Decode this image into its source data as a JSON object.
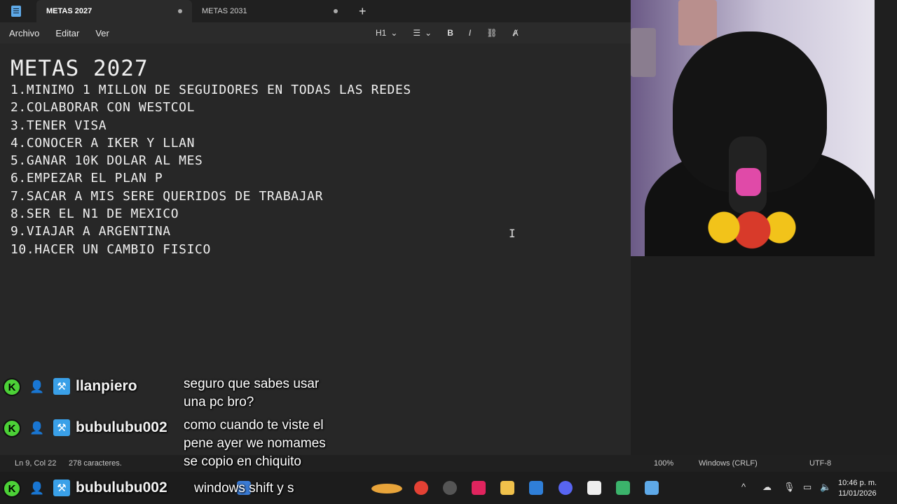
{
  "tabs": [
    {
      "label": "METAS 2027"
    },
    {
      "label": "METAS 2031"
    }
  ],
  "new_tab_label": "+",
  "menu": {
    "archivo": "Archivo",
    "editar": "Editar",
    "ver": "Ver"
  },
  "toolbar": {
    "heading": "H1",
    "bold": "B",
    "italic": "I"
  },
  "document": {
    "title": "METAS 2027",
    "lines": [
      "1.MINIMO 1 MILLON DE SEGUIDORES EN TODAS LAS REDES",
      "2.COLABORAR CON WESTCOL",
      "3.TENER VISA",
      "4.CONOCER A IKER Y LLAN",
      "5.GANAR 10K DOLAR AL MES",
      "6.EMPEZAR EL PLAN P",
      "7.SACAR A MIS SERE QUERIDOS DE TRABAJAR",
      "8.SER EL N1 DE MEXICO",
      "9.VIAJAR A ARGENTINA",
      "10.HACER UN CAMBIO FISICO"
    ]
  },
  "status": {
    "position": "Ln 9, Col 22",
    "chars": "278 caracteres.",
    "zoom": "100%",
    "eol": "Windows (CRLF)",
    "encoding": "UTF-8"
  },
  "chat": [
    {
      "badge": "K",
      "user": "llanpiero",
      "message": "seguro que sabes usar\nuna pc bro?"
    },
    {
      "badge": "K",
      "user": "bubulubu002",
      "message": "como cuando te viste el\npene ayer we nomames\nse copio en chiquito"
    },
    {
      "badge": "K",
      "user": "bubulubu002",
      "message": "windows shift y s"
    }
  ],
  "clock": {
    "time": "10:46 p. m.",
    "date": "11/01/2026"
  },
  "colors": {
    "chat_badge": "#4cd137",
    "accent": "#5ea9e8"
  }
}
